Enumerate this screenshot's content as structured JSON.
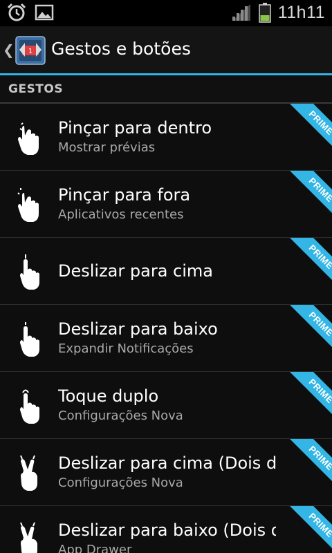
{
  "status_bar": {
    "time": "11h11",
    "icons": [
      "alarm-clock-icon",
      "image-icon",
      "signal-icon",
      "battery-icon"
    ],
    "battery_color": "#8bc34a"
  },
  "action_bar": {
    "title": "Gestos e botões",
    "up_glyph": "❮",
    "app_icon": "app-icon",
    "accent_color": "#33b5e5"
  },
  "section": {
    "label": "GESTOS"
  },
  "ribbon_label": "PRIME",
  "ribbon_color": "#33b5e5",
  "items": [
    {
      "title": "Pinçar para dentro",
      "subtitle": "Mostrar prévias",
      "icon": "pinch-in-gesture-icon"
    },
    {
      "title": "Pinçar para fora",
      "subtitle": "Aplicativos recentes",
      "icon": "pinch-out-gesture-icon"
    },
    {
      "title": "Deslizar para cima",
      "subtitle": "",
      "icon": "swipe-up-gesture-icon"
    },
    {
      "title": "Deslizar para baixo",
      "subtitle": "Expandir Notificações",
      "icon": "swipe-down-gesture-icon"
    },
    {
      "title": "Toque duplo",
      "subtitle": "Configurações Nova",
      "icon": "double-tap-gesture-icon"
    },
    {
      "title": "Deslizar para cima (Dois dedos)",
      "subtitle": "Configurações Nova",
      "icon": "two-finger-swipe-up-icon"
    },
    {
      "title": "Deslizar para baixo (Dois dedos)",
      "subtitle": "App Drawer",
      "icon": "two-finger-swipe-down-icon"
    }
  ]
}
